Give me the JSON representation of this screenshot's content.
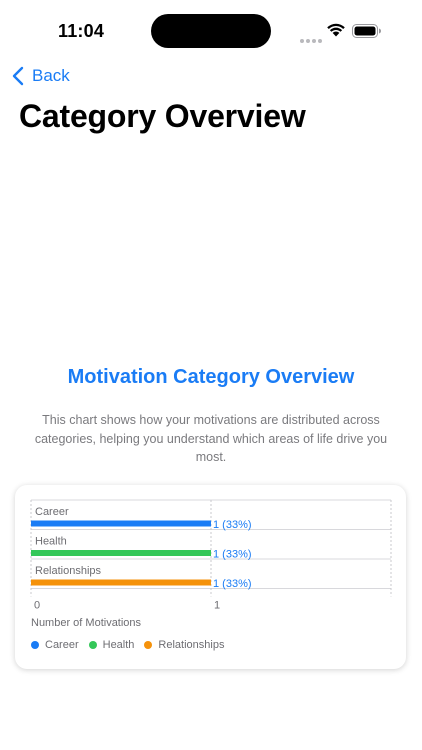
{
  "status_bar": {
    "time": "11:04"
  },
  "nav": {
    "back_label": "Back"
  },
  "page": {
    "title": "Category Overview"
  },
  "section": {
    "title": "Motivation Category Overview",
    "description": "This chart shows how your motivations are distributed across categories, helping you understand which areas of life drive you most."
  },
  "colors": {
    "accent": "#1a7cf5",
    "career": "#1a7cf5",
    "health": "#34c759",
    "relationships": "#f5920b"
  },
  "chart_data": {
    "type": "bar",
    "orientation": "horizontal",
    "categories": [
      "Career",
      "Health",
      "Relationships"
    ],
    "values": [
      1,
      1,
      1
    ],
    "value_labels": [
      "1 (33%)",
      "1 (33%)",
      "1 (33%)"
    ],
    "x_ticks": [
      "0",
      "1"
    ],
    "xlim": [
      0,
      1
    ],
    "xlabel": "Number of Motivations",
    "legend": [
      "Career",
      "Health",
      "Relationships"
    ],
    "legend_position": "bottom-left",
    "grid": true
  }
}
